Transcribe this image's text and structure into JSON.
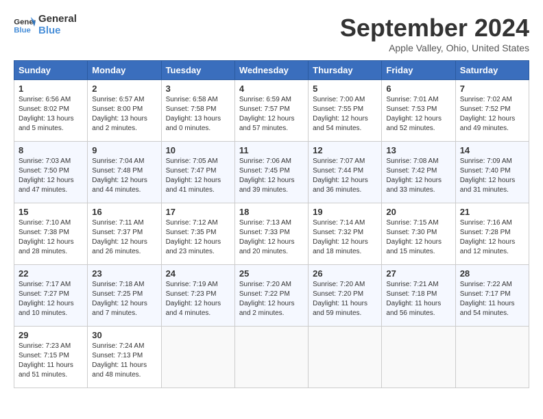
{
  "header": {
    "logo_line1": "General",
    "logo_line2": "Blue",
    "month": "September 2024",
    "location": "Apple Valley, Ohio, United States"
  },
  "days_of_week": [
    "Sunday",
    "Monday",
    "Tuesday",
    "Wednesday",
    "Thursday",
    "Friday",
    "Saturday"
  ],
  "weeks": [
    [
      {
        "day": "1",
        "info": "Sunrise: 6:56 AM\nSunset: 8:02 PM\nDaylight: 13 hours and 5 minutes."
      },
      {
        "day": "2",
        "info": "Sunrise: 6:57 AM\nSunset: 8:00 PM\nDaylight: 13 hours and 2 minutes."
      },
      {
        "day": "3",
        "info": "Sunrise: 6:58 AM\nSunset: 7:58 PM\nDaylight: 13 hours and 0 minutes."
      },
      {
        "day": "4",
        "info": "Sunrise: 6:59 AM\nSunset: 7:57 PM\nDaylight: 12 hours and 57 minutes."
      },
      {
        "day": "5",
        "info": "Sunrise: 7:00 AM\nSunset: 7:55 PM\nDaylight: 12 hours and 54 minutes."
      },
      {
        "day": "6",
        "info": "Sunrise: 7:01 AM\nSunset: 7:53 PM\nDaylight: 12 hours and 52 minutes."
      },
      {
        "day": "7",
        "info": "Sunrise: 7:02 AM\nSunset: 7:52 PM\nDaylight: 12 hours and 49 minutes."
      }
    ],
    [
      {
        "day": "8",
        "info": "Sunrise: 7:03 AM\nSunset: 7:50 PM\nDaylight: 12 hours and 47 minutes."
      },
      {
        "day": "9",
        "info": "Sunrise: 7:04 AM\nSunset: 7:48 PM\nDaylight: 12 hours and 44 minutes."
      },
      {
        "day": "10",
        "info": "Sunrise: 7:05 AM\nSunset: 7:47 PM\nDaylight: 12 hours and 41 minutes."
      },
      {
        "day": "11",
        "info": "Sunrise: 7:06 AM\nSunset: 7:45 PM\nDaylight: 12 hours and 39 minutes."
      },
      {
        "day": "12",
        "info": "Sunrise: 7:07 AM\nSunset: 7:44 PM\nDaylight: 12 hours and 36 minutes."
      },
      {
        "day": "13",
        "info": "Sunrise: 7:08 AM\nSunset: 7:42 PM\nDaylight: 12 hours and 33 minutes."
      },
      {
        "day": "14",
        "info": "Sunrise: 7:09 AM\nSunset: 7:40 PM\nDaylight: 12 hours and 31 minutes."
      }
    ],
    [
      {
        "day": "15",
        "info": "Sunrise: 7:10 AM\nSunset: 7:38 PM\nDaylight: 12 hours and 28 minutes."
      },
      {
        "day": "16",
        "info": "Sunrise: 7:11 AM\nSunset: 7:37 PM\nDaylight: 12 hours and 26 minutes."
      },
      {
        "day": "17",
        "info": "Sunrise: 7:12 AM\nSunset: 7:35 PM\nDaylight: 12 hours and 23 minutes."
      },
      {
        "day": "18",
        "info": "Sunrise: 7:13 AM\nSunset: 7:33 PM\nDaylight: 12 hours and 20 minutes."
      },
      {
        "day": "19",
        "info": "Sunrise: 7:14 AM\nSunset: 7:32 PM\nDaylight: 12 hours and 18 minutes."
      },
      {
        "day": "20",
        "info": "Sunrise: 7:15 AM\nSunset: 7:30 PM\nDaylight: 12 hours and 15 minutes."
      },
      {
        "day": "21",
        "info": "Sunrise: 7:16 AM\nSunset: 7:28 PM\nDaylight: 12 hours and 12 minutes."
      }
    ],
    [
      {
        "day": "22",
        "info": "Sunrise: 7:17 AM\nSunset: 7:27 PM\nDaylight: 12 hours and 10 minutes."
      },
      {
        "day": "23",
        "info": "Sunrise: 7:18 AM\nSunset: 7:25 PM\nDaylight: 12 hours and 7 minutes."
      },
      {
        "day": "24",
        "info": "Sunrise: 7:19 AM\nSunset: 7:23 PM\nDaylight: 12 hours and 4 minutes."
      },
      {
        "day": "25",
        "info": "Sunrise: 7:20 AM\nSunset: 7:22 PM\nDaylight: 12 hours and 2 minutes."
      },
      {
        "day": "26",
        "info": "Sunrise: 7:20 AM\nSunset: 7:20 PM\nDaylight: 11 hours and 59 minutes."
      },
      {
        "day": "27",
        "info": "Sunrise: 7:21 AM\nSunset: 7:18 PM\nDaylight: 11 hours and 56 minutes."
      },
      {
        "day": "28",
        "info": "Sunrise: 7:22 AM\nSunset: 7:17 PM\nDaylight: 11 hours and 54 minutes."
      }
    ],
    [
      {
        "day": "29",
        "info": "Sunrise: 7:23 AM\nSunset: 7:15 PM\nDaylight: 11 hours and 51 minutes."
      },
      {
        "day": "30",
        "info": "Sunrise: 7:24 AM\nSunset: 7:13 PM\nDaylight: 11 hours and 48 minutes."
      },
      {
        "day": "",
        "info": ""
      },
      {
        "day": "",
        "info": ""
      },
      {
        "day": "",
        "info": ""
      },
      {
        "day": "",
        "info": ""
      },
      {
        "day": "",
        "info": ""
      }
    ]
  ]
}
